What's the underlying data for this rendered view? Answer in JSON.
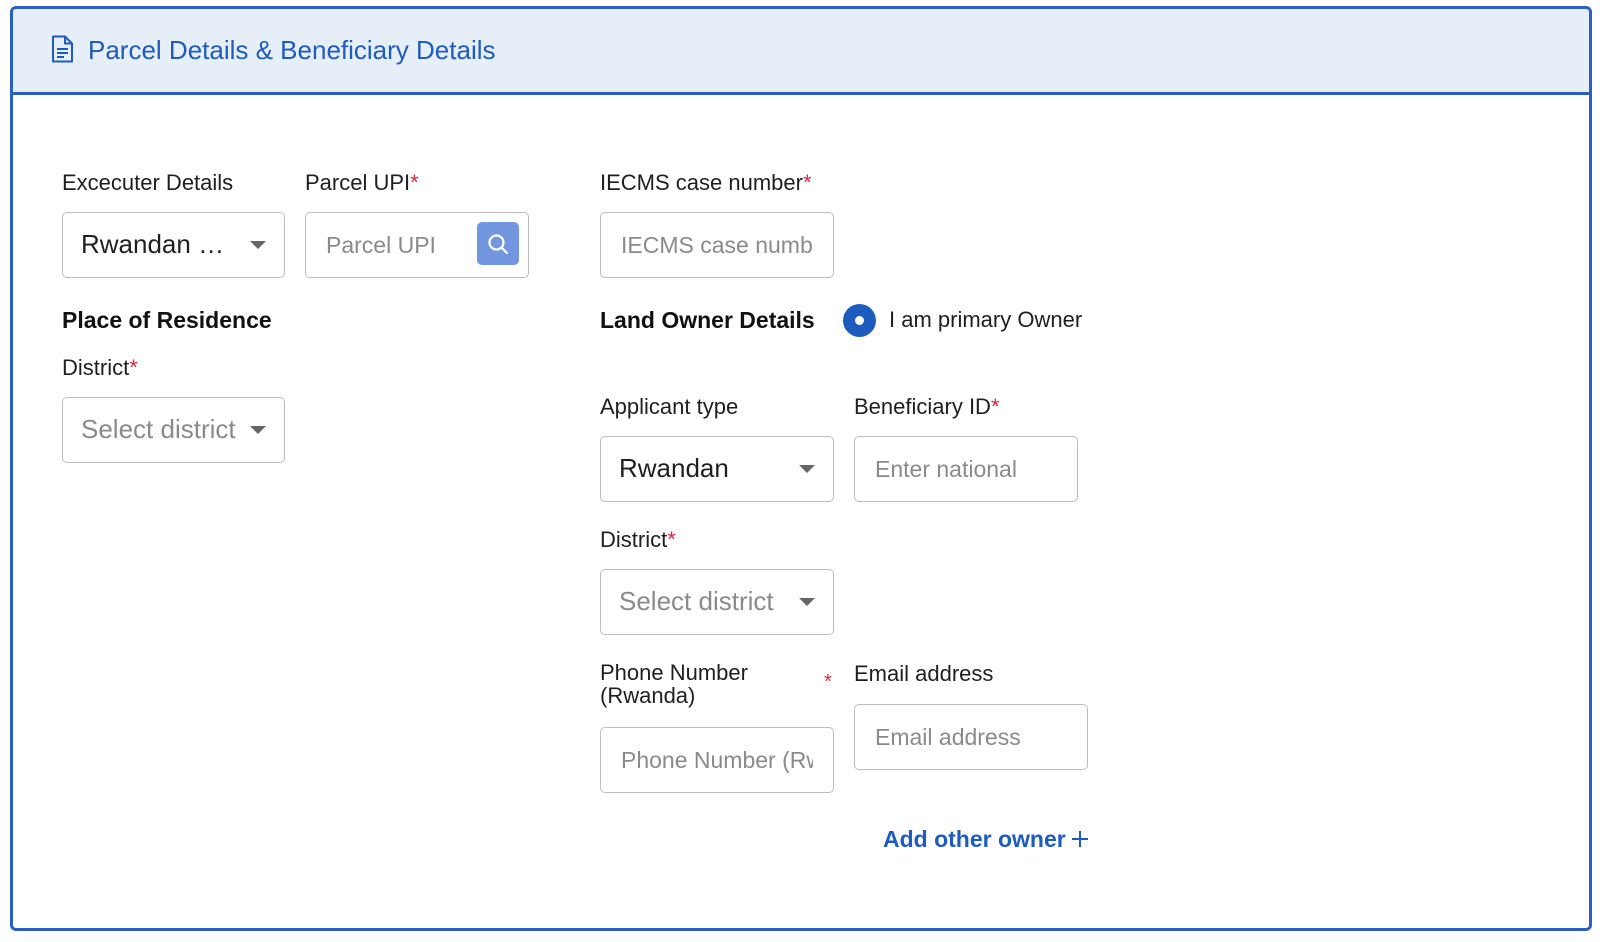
{
  "header": {
    "icon": "document-icon",
    "title": "Parcel Details & Beneficiary Details"
  },
  "executer": {
    "label": "Excecuter Details",
    "value": "Rwandan w..."
  },
  "parcel_upi": {
    "label": "Parcel UPI",
    "required_mark": "*",
    "placeholder": "Parcel UPI",
    "search_icon": "search-icon"
  },
  "iecms": {
    "label": "IECMS case number",
    "required_mark": "*",
    "placeholder": "IECMS case number"
  },
  "residence": {
    "title": "Place of Residence",
    "district_label": "District",
    "required_mark": "*",
    "district_placeholder": "Select district"
  },
  "land_owner": {
    "title": "Land Owner Details",
    "radio_label": "I am primary Owner",
    "applicant_type_label": "Applicant type",
    "applicant_type_value": "Rwandan",
    "beneficiary_label": "Beneficiary ID",
    "beneficiary_required_mark": "*",
    "beneficiary_placeholder": "Enter national",
    "district_label": "District",
    "district_required_mark": "*",
    "district_placeholder": "Select district",
    "phone_label": "Phone Number (Rwanda)",
    "phone_required_mark": "*",
    "phone_placeholder": "Phone Number (Rwanda)",
    "email_label": "Email address",
    "email_placeholder": "Email address",
    "add_owner_label": "Add other owner",
    "add_icon": "plus-icon"
  },
  "colors": {
    "accent": "#1d5bbf",
    "border": "#2c5fc4",
    "header_bg": "#e6eef8",
    "required": "#e0263c",
    "search_button": "#7396e0"
  }
}
